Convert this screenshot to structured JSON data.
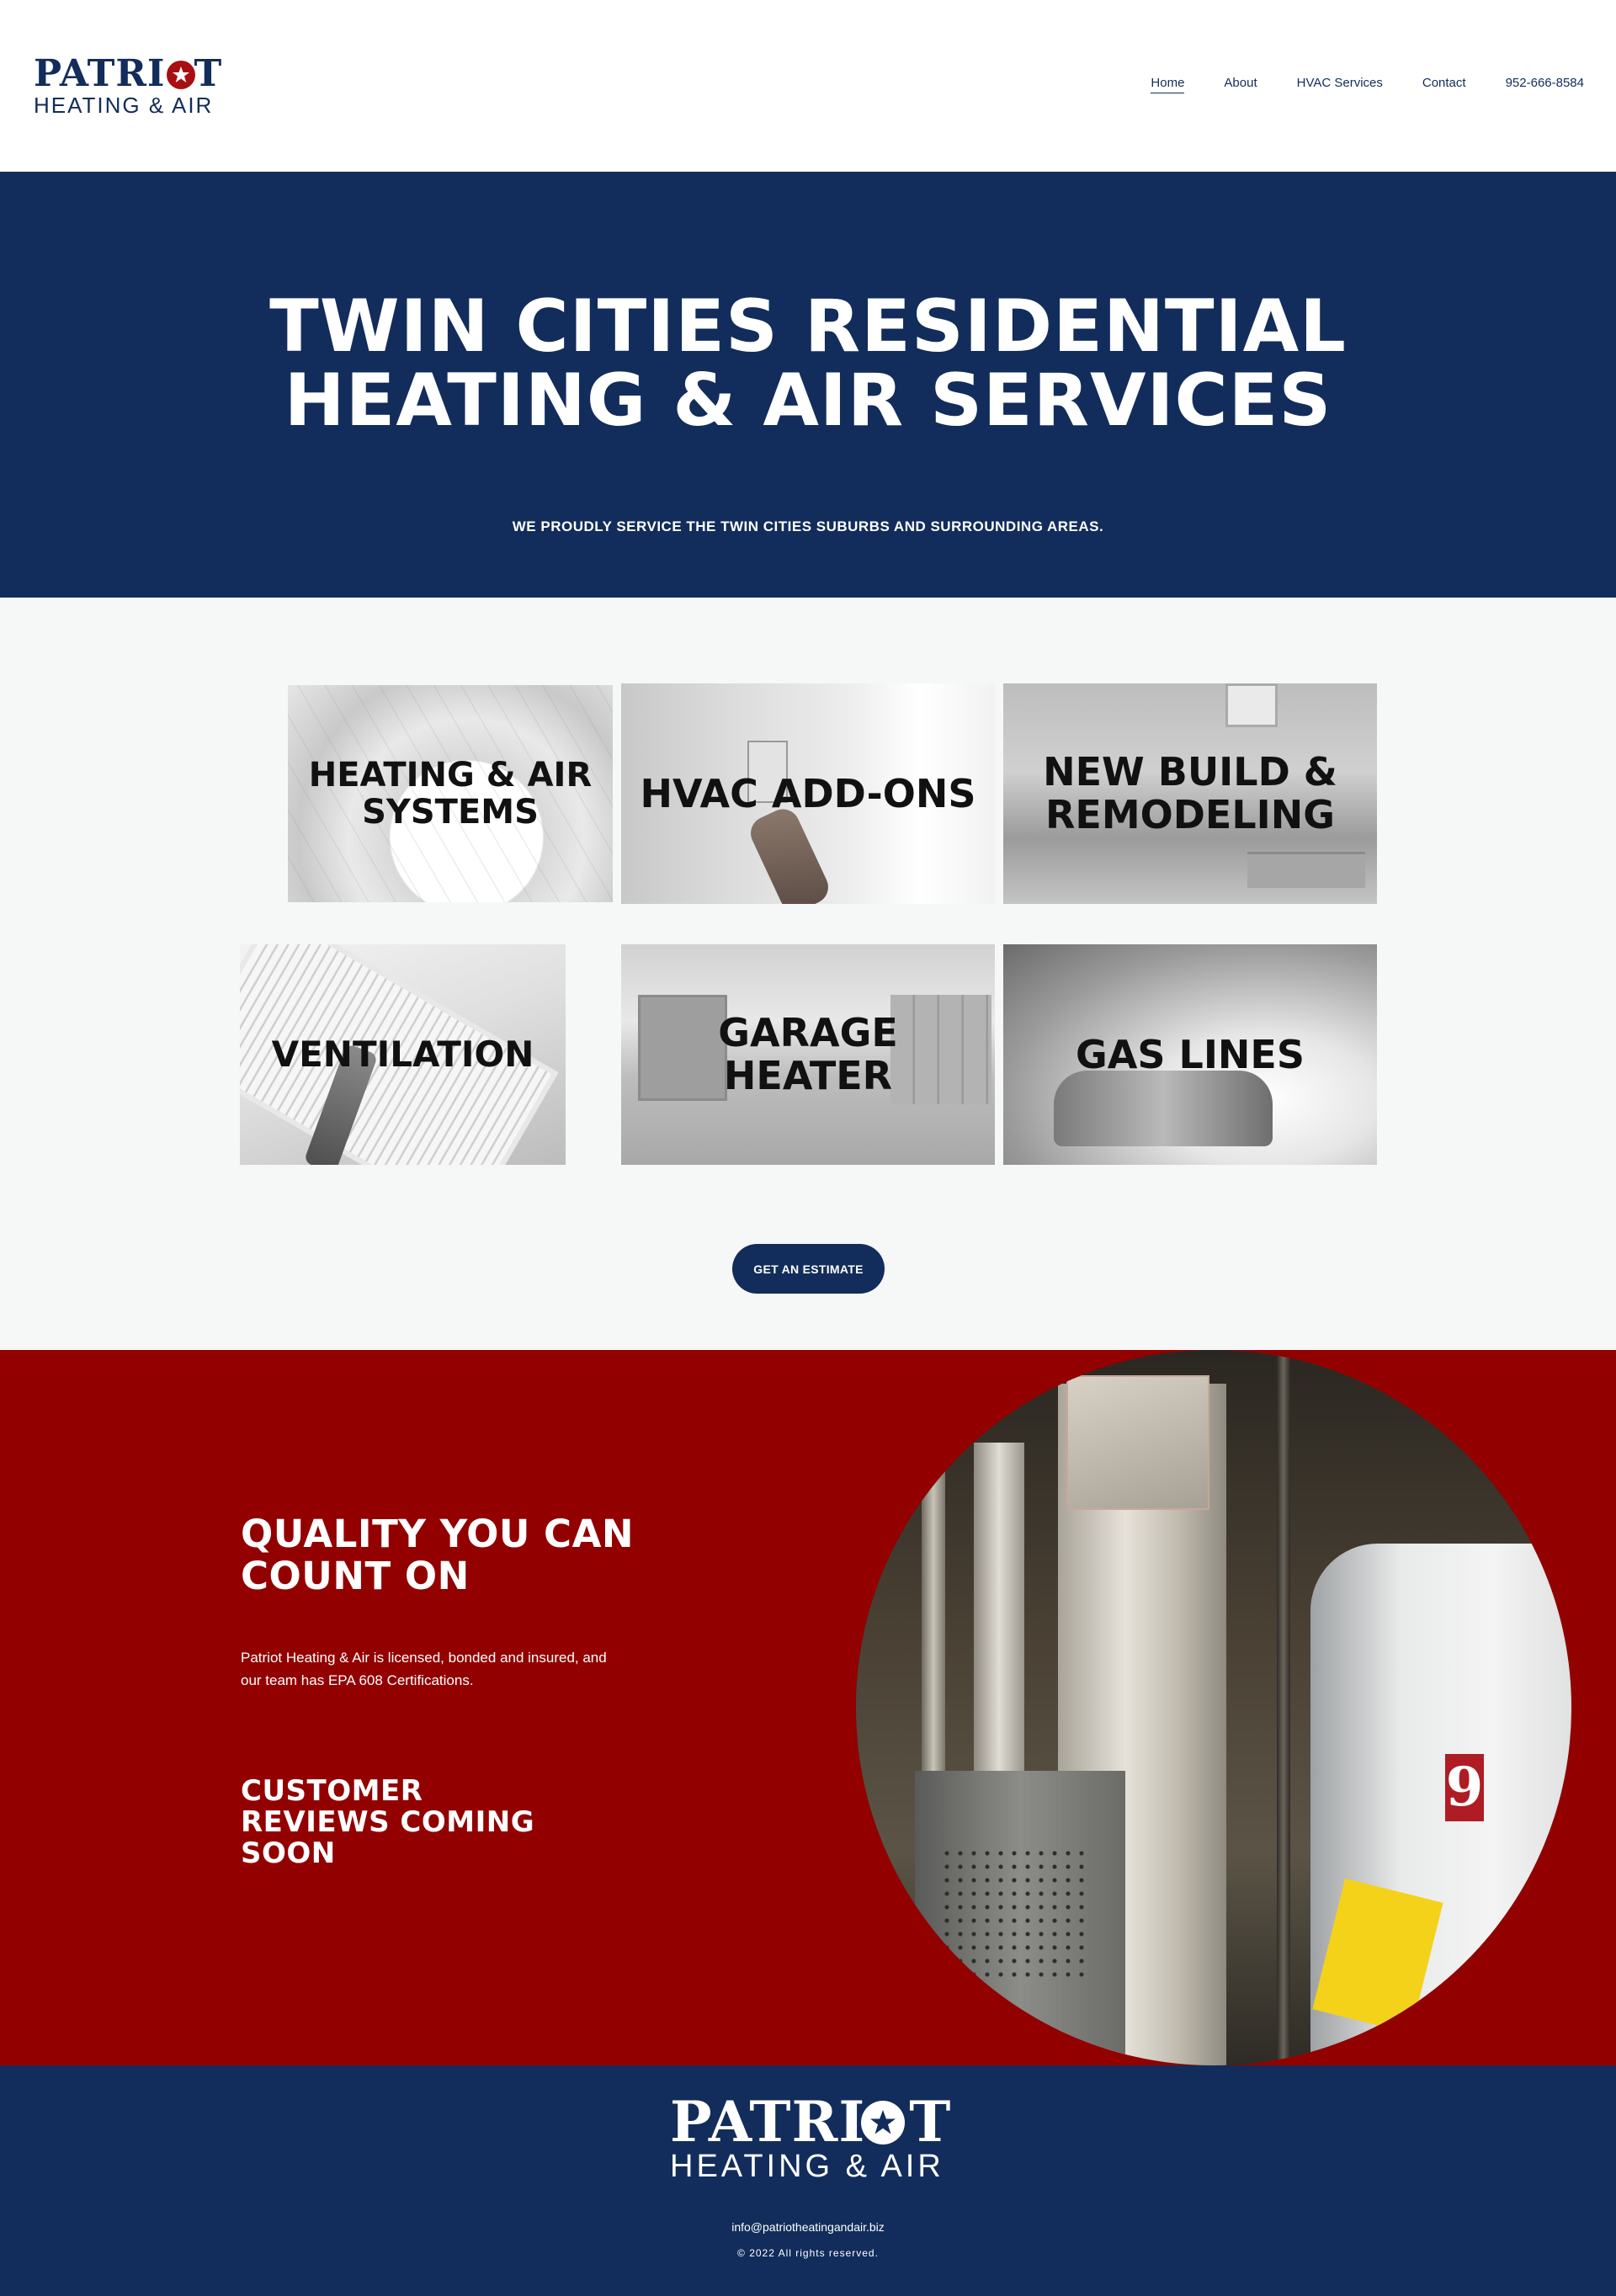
{
  "brand": {
    "name_main": "PATRI",
    "name_o": "O",
    "name_end": "T",
    "name_sub": "HEATING & AIR",
    "primary_color": "#122d5b",
    "accent_color": "#930000"
  },
  "nav": {
    "items": [
      {
        "label": "Home",
        "active": true
      },
      {
        "label": "About"
      },
      {
        "label": "HVAC Services"
      },
      {
        "label": "Contact"
      },
      {
        "label": "952-666-8584"
      }
    ]
  },
  "hero": {
    "title_line1": "TWIN CITIES RESIDENTIAL",
    "title_line2": "HEATING & AIR SERVICES",
    "subtitle": "WE PROUDLY SERVICE THE TWIN CITIES SUBURBS AND SURROUNDING AREAS."
  },
  "services": {
    "tiles": [
      {
        "line1": "HEATING & AIR",
        "line2": "SYSTEMS"
      },
      {
        "line1": "HVAC ADD-ONS",
        "line2": ""
      },
      {
        "line1": "NEW BUILD &",
        "line2": "REMODELING"
      },
      {
        "line1": "VENTILATION",
        "line2": ""
      },
      {
        "line1": "GARAGE",
        "line2": "HEATER"
      },
      {
        "line1": "GAS LINES",
        "line2": ""
      }
    ],
    "cta_label": "GET AN ESTIMATE"
  },
  "quality": {
    "title_line1": "QUALITY YOU CAN",
    "title_line2": "COUNT ON",
    "body_line1": "Patriot Heating & Air is licensed, bonded and insured, and",
    "body_line2": "our team has EPA 608 Certifications.",
    "reviews_line1": "CUSTOMER",
    "reviews_line2": "REVIEWS COMING",
    "reviews_line3": "SOON",
    "photo_icon": "furnace-photo",
    "heater_digit": "9"
  },
  "footer": {
    "email": "info@patriotheatingandair.biz",
    "copyright": "© 2022 All rights reserved."
  }
}
